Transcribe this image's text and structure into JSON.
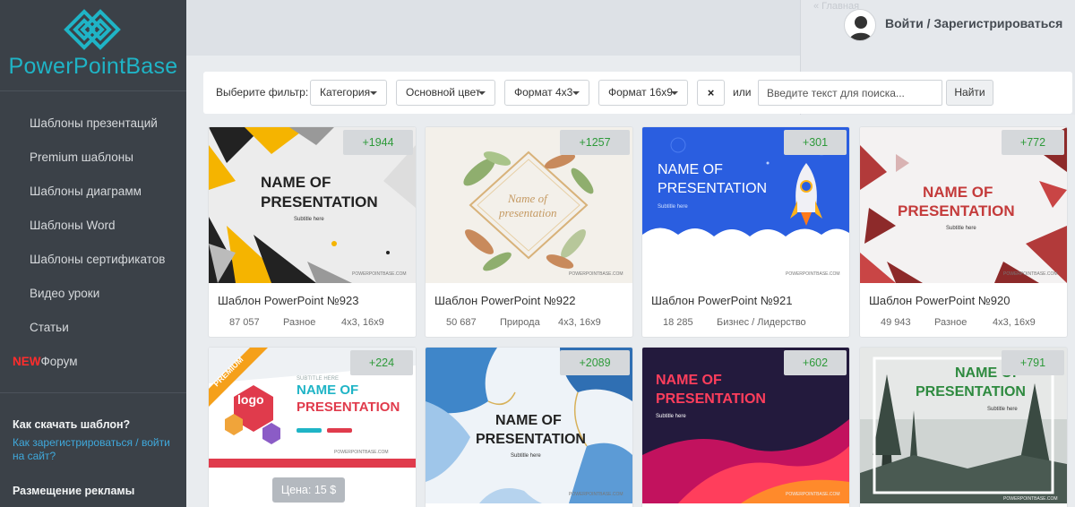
{
  "brand": {
    "name": "PowerPointBase"
  },
  "sidebar": {
    "items": [
      {
        "label": "Шаблоны презентаций"
      },
      {
        "label": "Premium шаблоны"
      },
      {
        "label": "Шаблоны диаграмм"
      },
      {
        "label": "Шаблоны Word"
      },
      {
        "label": "Шаблоны сертификатов"
      },
      {
        "label": "Видео уроки"
      },
      {
        "label": "Статьи"
      }
    ],
    "forum": {
      "badge": "NEW",
      "label": "Форум"
    },
    "help": {
      "heading": "Как скачать шаблон?",
      "link": "Как зарегистрироваться / войти на сайт?"
    },
    "ads": {
      "heading": "Размещение рекламы"
    }
  },
  "header": {
    "faded_text": "« Главная",
    "login": "Войти / Зарегистрироваться"
  },
  "filter": {
    "label": "Выберите фильтр:",
    "category": "Категория",
    "color": "Основной цвет",
    "format43": "Формат 4x3",
    "format169": "Формат 16x9",
    "clear": "×",
    "or": "или",
    "search_placeholder": "Введите текст для поиска...",
    "search_button": "Найти"
  },
  "cards": [
    {
      "count": "+1944",
      "title": "Шаблон PowerPoint №923",
      "views": "87 057",
      "category": "Разное",
      "formats": "4x3, 16x9"
    },
    {
      "count": "+1257",
      "title": "Шаблон PowerPoint №922",
      "views": "50 687",
      "category": "Природа",
      "formats": "4x3, 16x9"
    },
    {
      "count": "+301",
      "title": "Шаблон PowerPoint №921",
      "views": "18 285",
      "category": "Бизнес / Лидерство",
      "formats": ""
    },
    {
      "count": "+772",
      "title": "Шаблон PowerPoint №920",
      "views": "49 943",
      "category": "Разное",
      "formats": "4x3, 16x9"
    },
    {
      "count": "+224",
      "price": "Цена: 15 $"
    },
    {
      "count": "+2089"
    },
    {
      "count": "+602"
    },
    {
      "count": "+791"
    }
  ],
  "thumbnails": {
    "t923": {
      "title1": "NAME OF",
      "title2": "PRESENTATION",
      "subtitle": "Subtitle here",
      "watermark": "POWERPOINTBASE.COM"
    },
    "t922": {
      "title1": "Name of",
      "title2": "presentation",
      "watermark": "POWERPOINTBASE.COM"
    },
    "t921": {
      "title1": "NAME OF",
      "title2": "PRESENTATION",
      "subtitle": "Subtitle here",
      "watermark": "POWERPOINTBASE.COM"
    },
    "t920": {
      "title1": "NAME OF",
      "title2": "PRESENTATION",
      "subtitle": "Subtitle here",
      "watermark": "POWERPOINTBASE.COM"
    },
    "tp": {
      "ribbon": "PREMIUM",
      "logo": "logo",
      "subtitle_top": "SUBTITLE HERE",
      "title1": "NAME OF",
      "title2": "PRESENTATION",
      "watermark": "POWERPOINTBASE.COM"
    },
    "t2089": {
      "title1": "NAME OF",
      "title2": "PRESENTATION",
      "subtitle": "Subtitle here",
      "watermark": "POWERPOINTBASE.COM"
    },
    "t602": {
      "title1": "NAME OF",
      "title2": "PRESENTATION",
      "subtitle": "Subtitle here",
      "watermark": "POWERPOINTBASE.COM"
    },
    "t791": {
      "title1": "NAME OF",
      "title2": "PRESENTATION",
      "subtitle": "Subtitle here",
      "watermark": "POWERPOINTBASE.COM"
    }
  },
  "colors": {
    "sidebar_bg": "#3b4148",
    "brand_teal": "#1fb4c6",
    "count_green": "#2e9a3a",
    "link_blue": "#3fa9dc",
    "new_red": "#ff2d2d"
  }
}
